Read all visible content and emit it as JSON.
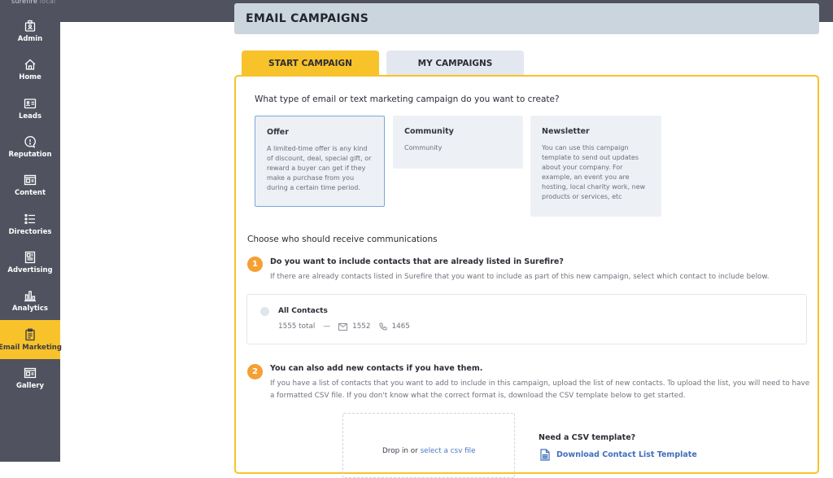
{
  "app": {
    "logo_main": "surefire",
    "logo_sub": "local"
  },
  "sidebar": {
    "items": [
      {
        "label": "Admin",
        "icon": "admin-badge-icon",
        "active": false
      },
      {
        "label": "Home",
        "icon": "home-icon",
        "active": false
      },
      {
        "label": "Leads",
        "icon": "leads-card-icon",
        "active": false
      },
      {
        "label": "Reputation",
        "icon": "reputation-alert-icon",
        "active": false
      },
      {
        "label": "Content",
        "icon": "content-icon",
        "active": false
      },
      {
        "label": "Directories",
        "icon": "list-icon",
        "active": false
      },
      {
        "label": "Advertising",
        "icon": "advertising-icon",
        "active": false
      },
      {
        "label": "Analytics",
        "icon": "bar-chart-icon",
        "active": false
      },
      {
        "label": "Email Marketing",
        "icon": "clipboard-icon",
        "active": true
      },
      {
        "label": "Gallery",
        "icon": "gallery-icon",
        "active": false
      }
    ]
  },
  "header": {
    "title": "EMAIL CAMPAIGNS"
  },
  "tabs": [
    {
      "label": "START CAMPAIGN",
      "active": true
    },
    {
      "label": "MY CAMPAIGNS",
      "active": false
    }
  ],
  "campaign_type": {
    "question": "What type of email or text marketing campaign do you want to create?",
    "options": [
      {
        "title": "Offer",
        "description": "A limited-time offer is any kind of discount, deal, special gift, or reward a buyer can get if they make a purchase from you during a certain time period.",
        "selected": true
      },
      {
        "title": "Community",
        "description": "Community",
        "selected": false
      },
      {
        "title": "Newsletter",
        "description": "You can use this campaign template to send out updates about your company. For example, an event you are hosting, local charity work, new products or services, etc",
        "selected": false
      }
    ]
  },
  "recipients": {
    "title": "Choose who should receive communications",
    "step1": {
      "number": "1",
      "title": "Do you want to include contacts that are already listed in Surefire?",
      "description": "If there are already contacts listed in Surefire that you want to include as part of this new campaign, select which contact to include below."
    },
    "contacts": {
      "name": "All Contacts",
      "total": "1555 total",
      "separator": "—",
      "email_count": "1552",
      "phone_count": "1465"
    },
    "step2": {
      "number": "2",
      "title": "You can also add new contacts if you have them.",
      "description": "If you have a list of contacts that you want to add to include in this campaign, upload the list of new contacts. To upload the list, you will need to have a formatted CSV file. If you don't know what the correct format is, download the CSV template below to get started."
    },
    "upload": {
      "drop_text": "Drop in or ",
      "select_link": "select a csv file"
    },
    "template": {
      "question": "Need a CSV template?",
      "link": "Download Contact List Template"
    }
  },
  "colors": {
    "accent": "#f8c22a",
    "sidebar": "#50525f",
    "step_badge": "#f5a033",
    "link": "#3f6fbb"
  }
}
